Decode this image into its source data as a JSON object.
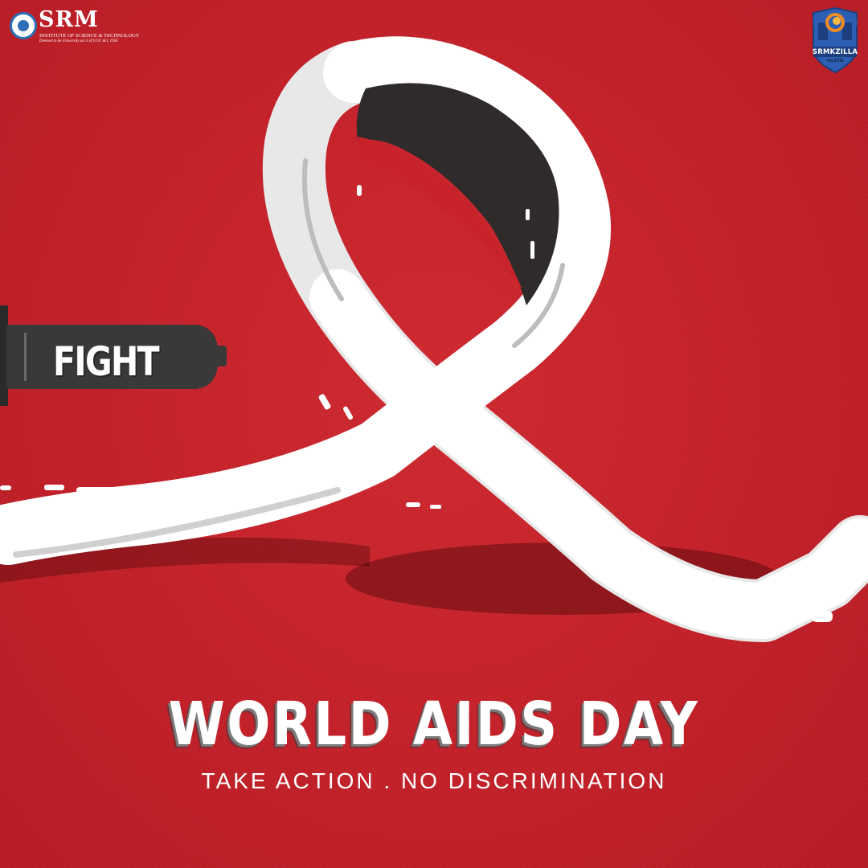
{
  "branding": {
    "srm": {
      "name": "SRM",
      "subtitle": "INSTITUTE OF SCIENCE & TECHNOLOGY",
      "subnote": "Deemed to be University u/s 3 of UGC Act, 1956",
      "accent_color": "#2c6fb7"
    },
    "srmkzilla": {
      "name": "SRMKZILLA",
      "sub": "mozilla",
      "accent_color": "#2c5fb3",
      "icon": "shield-icon"
    }
  },
  "artwork": {
    "syringe_label": "FIGHT",
    "ribbon": "awareness-ribbon",
    "background_color": "#c8232b",
    "ribbon_color": "#ffffff"
  },
  "headline": {
    "title": "WORLD AIDS DAY",
    "tagline": "TAKE ACTION . NO DISCRIMINATION"
  }
}
